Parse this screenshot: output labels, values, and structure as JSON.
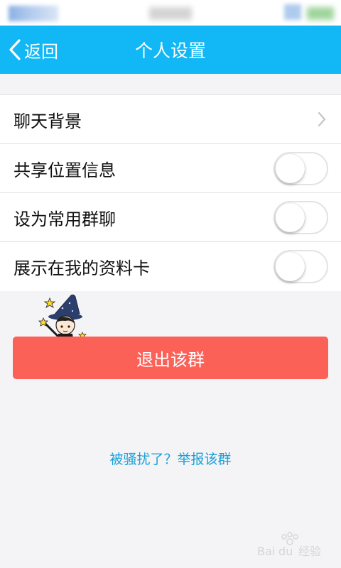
{
  "header": {
    "back_label": "返回",
    "title": "个人设置"
  },
  "settings": {
    "items": [
      {
        "label": "聊天背景",
        "control": "chevron"
      },
      {
        "label": "共享位置信息",
        "control": "toggle",
        "on": false
      },
      {
        "label": "设为常用群聊",
        "control": "toggle",
        "on": false
      },
      {
        "label": "展示在我的资料卡",
        "control": "toggle",
        "on": false
      }
    ]
  },
  "actions": {
    "exit_label": "退出该群",
    "report_label": "被骚扰了？举报该群"
  },
  "watermark": {
    "text": "Baidu 经验"
  },
  "colors": {
    "header_bg": "#12b7f5",
    "exit_button": "#fc6157",
    "link": "#1a9fd6",
    "page_bg": "#f4f4f7"
  }
}
